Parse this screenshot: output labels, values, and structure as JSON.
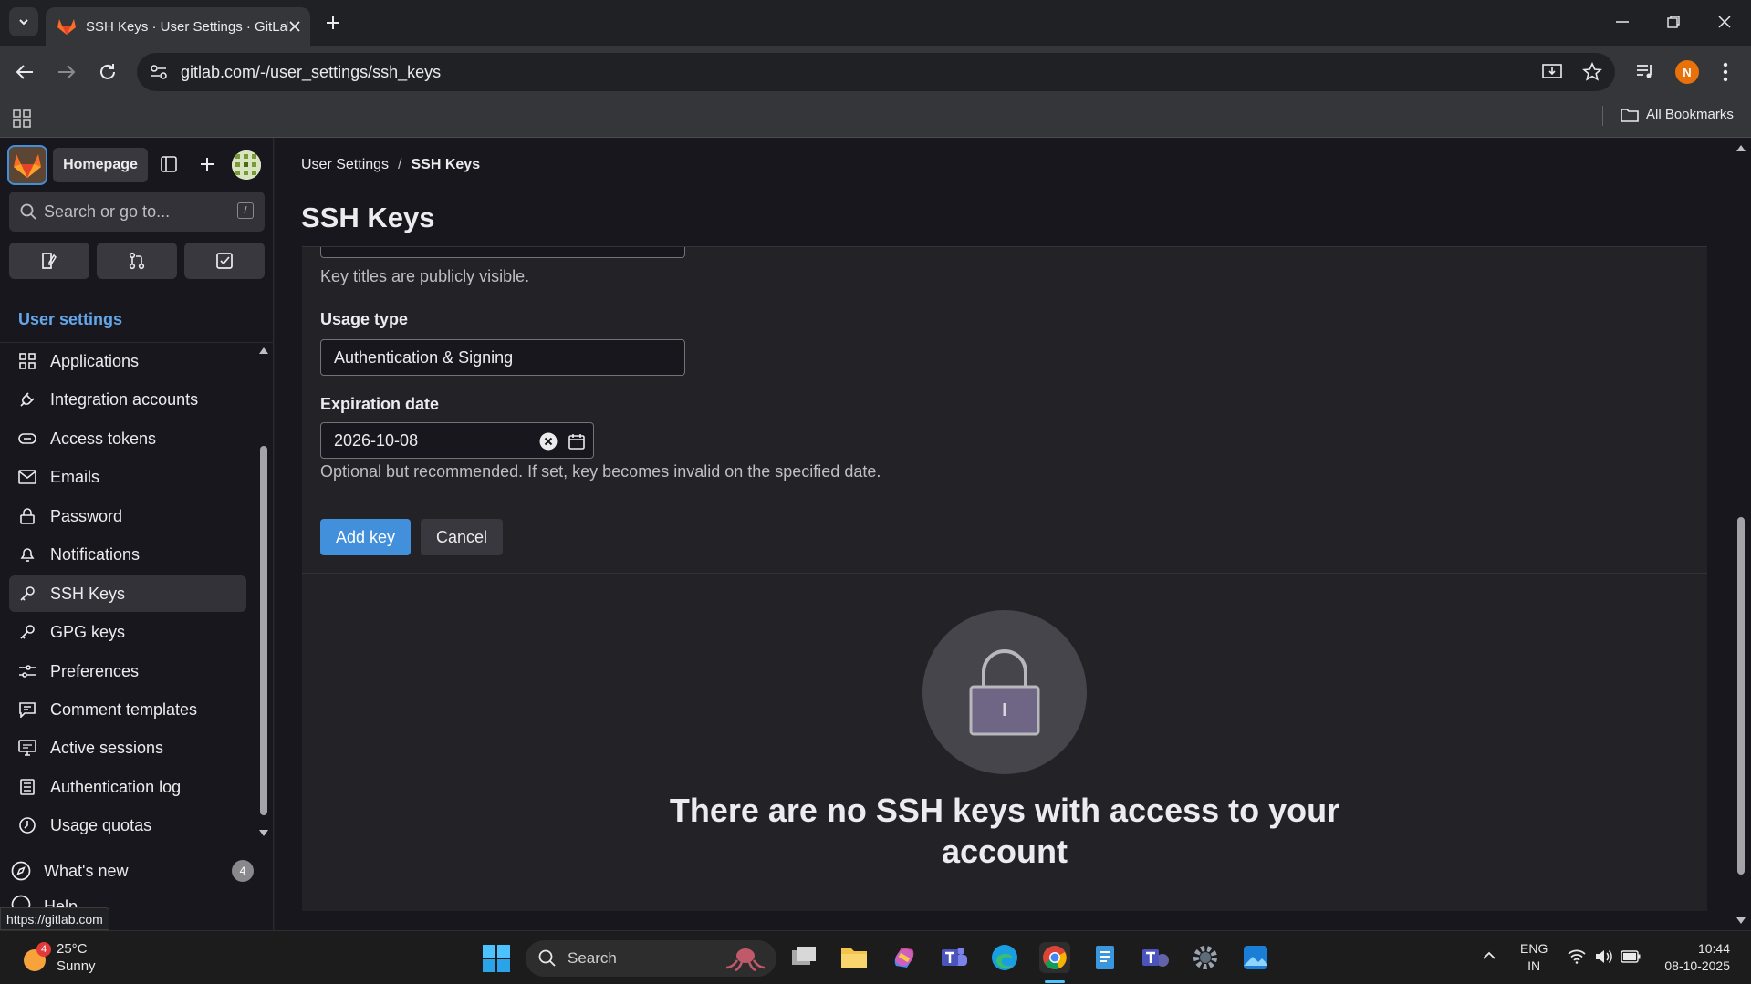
{
  "browser": {
    "tab_title": "SSH Keys · User Settings · GitLab",
    "url": "gitlab.com/-/user_settings/ssh_keys",
    "bookmarks_label": "All Bookmarks",
    "profile_initial": "N",
    "status_url": "https://gitlab.com"
  },
  "sidebar": {
    "homepage_label": "Homepage",
    "search_placeholder": "Search or go to...",
    "search_shortcut": "/",
    "section_title": "User settings",
    "items": [
      {
        "label": "Applications",
        "icon": "applications-icon"
      },
      {
        "label": "Integration accounts",
        "icon": "plug-icon"
      },
      {
        "label": "Access tokens",
        "icon": "token-icon"
      },
      {
        "label": "Emails",
        "icon": "mail-icon"
      },
      {
        "label": "Password",
        "icon": "lock-icon"
      },
      {
        "label": "Notifications",
        "icon": "bell-icon"
      },
      {
        "label": "SSH Keys",
        "icon": "key-icon",
        "active": true
      },
      {
        "label": "GPG keys",
        "icon": "key-icon"
      },
      {
        "label": "Preferences",
        "icon": "preferences-icon"
      },
      {
        "label": "Comment templates",
        "icon": "comment-icon"
      },
      {
        "label": "Active sessions",
        "icon": "monitor-icon"
      },
      {
        "label": "Authentication log",
        "icon": "log-icon"
      },
      {
        "label": "Usage quotas",
        "icon": "quota-icon"
      }
    ],
    "whats_new_label": "What's new",
    "whats_new_count": "4",
    "help_label": "Help"
  },
  "breadcrumb": {
    "parent": "User Settings",
    "separator": "/",
    "current": "SSH Keys"
  },
  "page": {
    "title": "SSH Keys",
    "key_title_help": "Key titles are publicly visible.",
    "usage_type_label": "Usage type",
    "usage_type_value": "Authentication & Signing",
    "expiration_label": "Expiration date",
    "expiration_value": "2026-10-08",
    "expiration_help": "Optional but recommended. If set, key becomes invalid on the specified date.",
    "add_key_label": "Add key",
    "cancel_label": "Cancel",
    "empty_state_line1": "There are no SSH keys with access to your",
    "empty_state_line2": "account"
  },
  "taskbar": {
    "weather_temp": "25°C",
    "weather_desc": "Sunny",
    "weather_badge": "4",
    "search_label": "Search",
    "lang_line1": "ENG",
    "lang_line2": "IN",
    "time": "10:44",
    "date": "08-10-2025"
  },
  "colors": {
    "accent_blue": "#428fdc",
    "sidebar_link": "#63a6e9",
    "gitlab_orange": "#fc6d26"
  }
}
